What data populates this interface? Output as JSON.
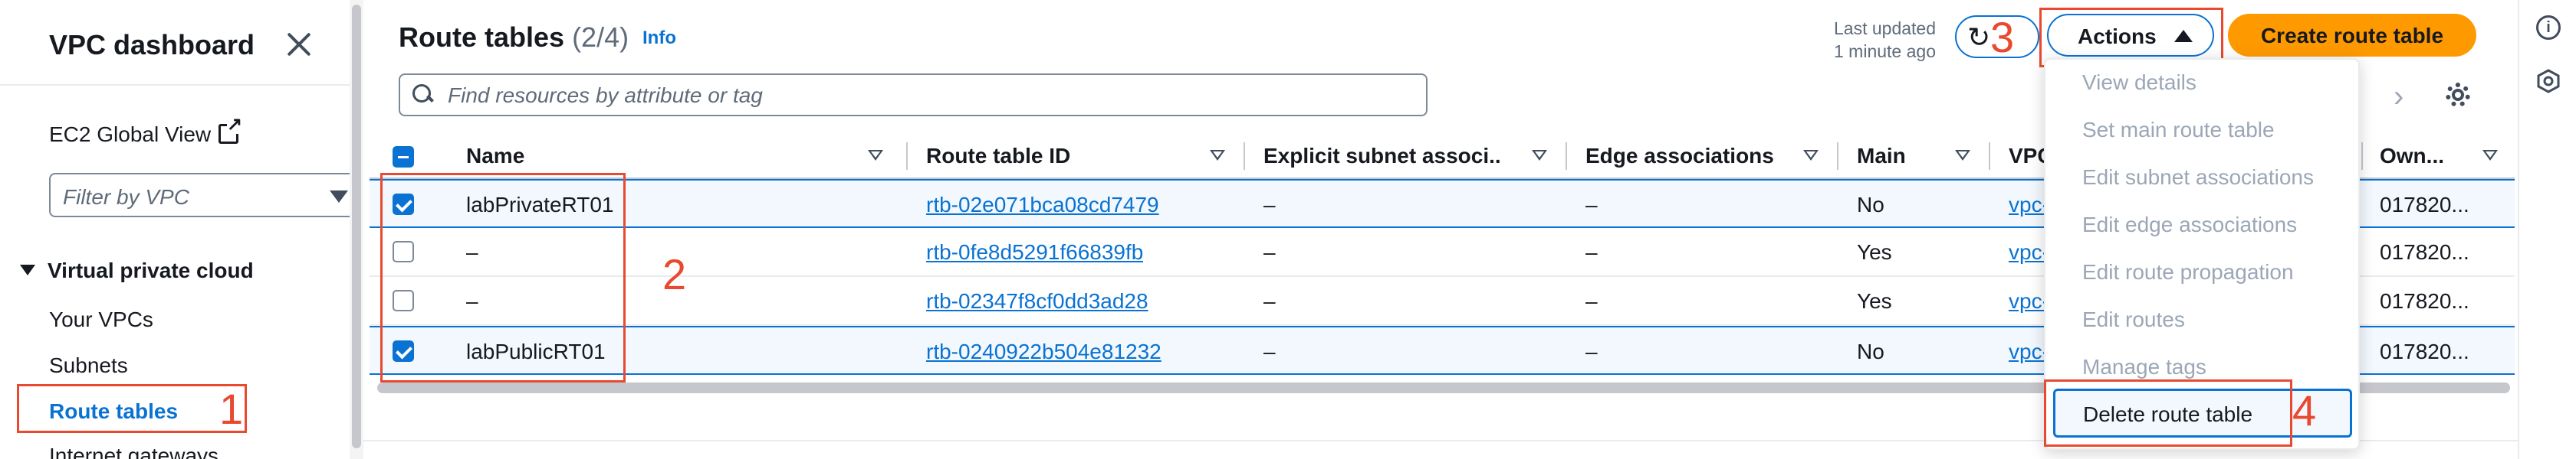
{
  "sidebar": {
    "title": "VPC dashboard",
    "ec2_global_view": "EC2 Global View",
    "filter_placeholder": "Filter by VPC",
    "section": "Virtual private cloud",
    "items": [
      "Your VPCs",
      "Subnets",
      "Route tables",
      "Internet gateways"
    ],
    "active_item": "Route tables"
  },
  "header": {
    "title": "Route tables",
    "count": "(2/4)",
    "info": "Info",
    "last_updated_line1": "Last updated",
    "last_updated_line2": "1 minute ago",
    "actions_label": "Actions",
    "create_label": "Create route table",
    "search_placeholder": "Find resources by attribute or tag"
  },
  "table": {
    "columns": [
      "Name",
      "Route table ID",
      "Explicit subnet associ...",
      "Edge associations",
      "Main",
      "VPC",
      "Own..."
    ],
    "rows": [
      {
        "selected": true,
        "name": "labPrivateRT01",
        "id": "rtb-02e071bca08cd7479",
        "explicit": "–",
        "edge": "–",
        "main": "No",
        "vpc": "vpc-",
        "owner": "017820..."
      },
      {
        "selected": false,
        "name": "–",
        "id": "rtb-0fe8d5291f66839fb",
        "explicit": "–",
        "edge": "–",
        "main": "Yes",
        "vpc": "vpc-",
        "owner": "017820..."
      },
      {
        "selected": false,
        "name": "–",
        "id": "rtb-02347f8cf0dd3ad28",
        "explicit": "–",
        "edge": "–",
        "main": "Yes",
        "vpc": "vpc-",
        "owner": "017820..."
      },
      {
        "selected": true,
        "name": "labPublicRT01",
        "id": "rtb-0240922b504e81232",
        "explicit": "–",
        "edge": "–",
        "main": "No",
        "vpc": "vpc-",
        "owner": "017820..."
      }
    ]
  },
  "actions_menu": {
    "items": [
      "View details",
      "Set main route table",
      "Edit subnet associations",
      "Edit edge associations",
      "Edit route propagation",
      "Edit routes",
      "Manage tags"
    ],
    "highlighted": "Delete route table"
  },
  "annotations": [
    "1",
    "2",
    "3",
    "4"
  ],
  "colors": {
    "accent": "#0972d3",
    "primary_button": "#ff9900",
    "annotation": "#e8492f",
    "selected_row_bg": "#f2f8fd",
    "disabled_text": "#9ba7b6"
  },
  "icons": [
    "close-icon",
    "external-link-icon",
    "caret-down-icon",
    "search-icon",
    "refresh-icon",
    "caret-up-icon",
    "chevron-right-icon",
    "gear-icon",
    "sort-icon",
    "info-icon",
    "hexagon-icon"
  ]
}
